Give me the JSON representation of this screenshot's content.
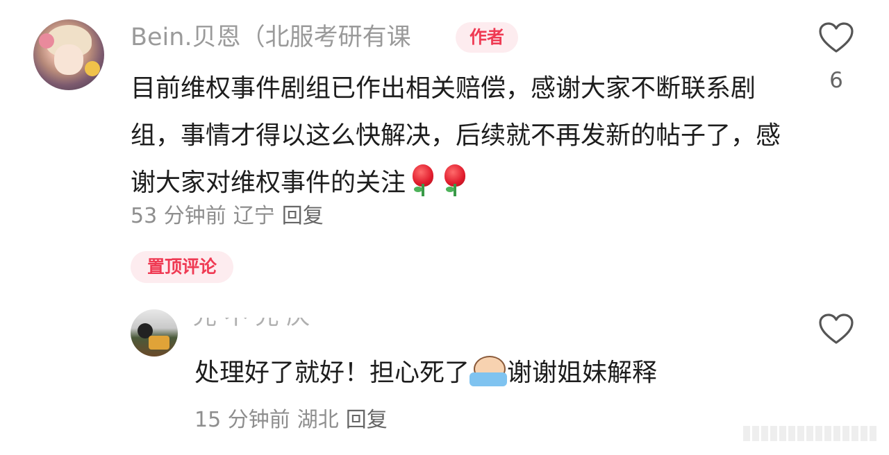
{
  "author_comment": {
    "username": "Bein.贝恩（北服考研有课",
    "author_badge": "作者",
    "text": "目前维权事件剧组已作出相关赔偿，感谢大家不断联系剧组，事情才得以这么快解决，后续就不再发新的帖子了，感谢大家对维权事件的关注",
    "emoji": [
      "rose",
      "rose"
    ],
    "time": "53 分钟前",
    "location": "辽宁",
    "reply_label": "回复",
    "pinned_label": "置顶评论",
    "like_count": "6",
    "like_icon": "heart-outline-icon"
  },
  "reply_comment": {
    "text_before": "处理好了就好！担心死了",
    "text_after": "谢谢姐妹解释",
    "emoji": "crying",
    "time": "15 分钟前",
    "location": "湖北",
    "reply_label": "回复",
    "like_icon": "heart-outline-icon"
  },
  "colors": {
    "accent": "#ef3a53",
    "badge_bg": "#fdecef",
    "text": "#1d1d1d",
    "meta": "#8e8e8e"
  }
}
